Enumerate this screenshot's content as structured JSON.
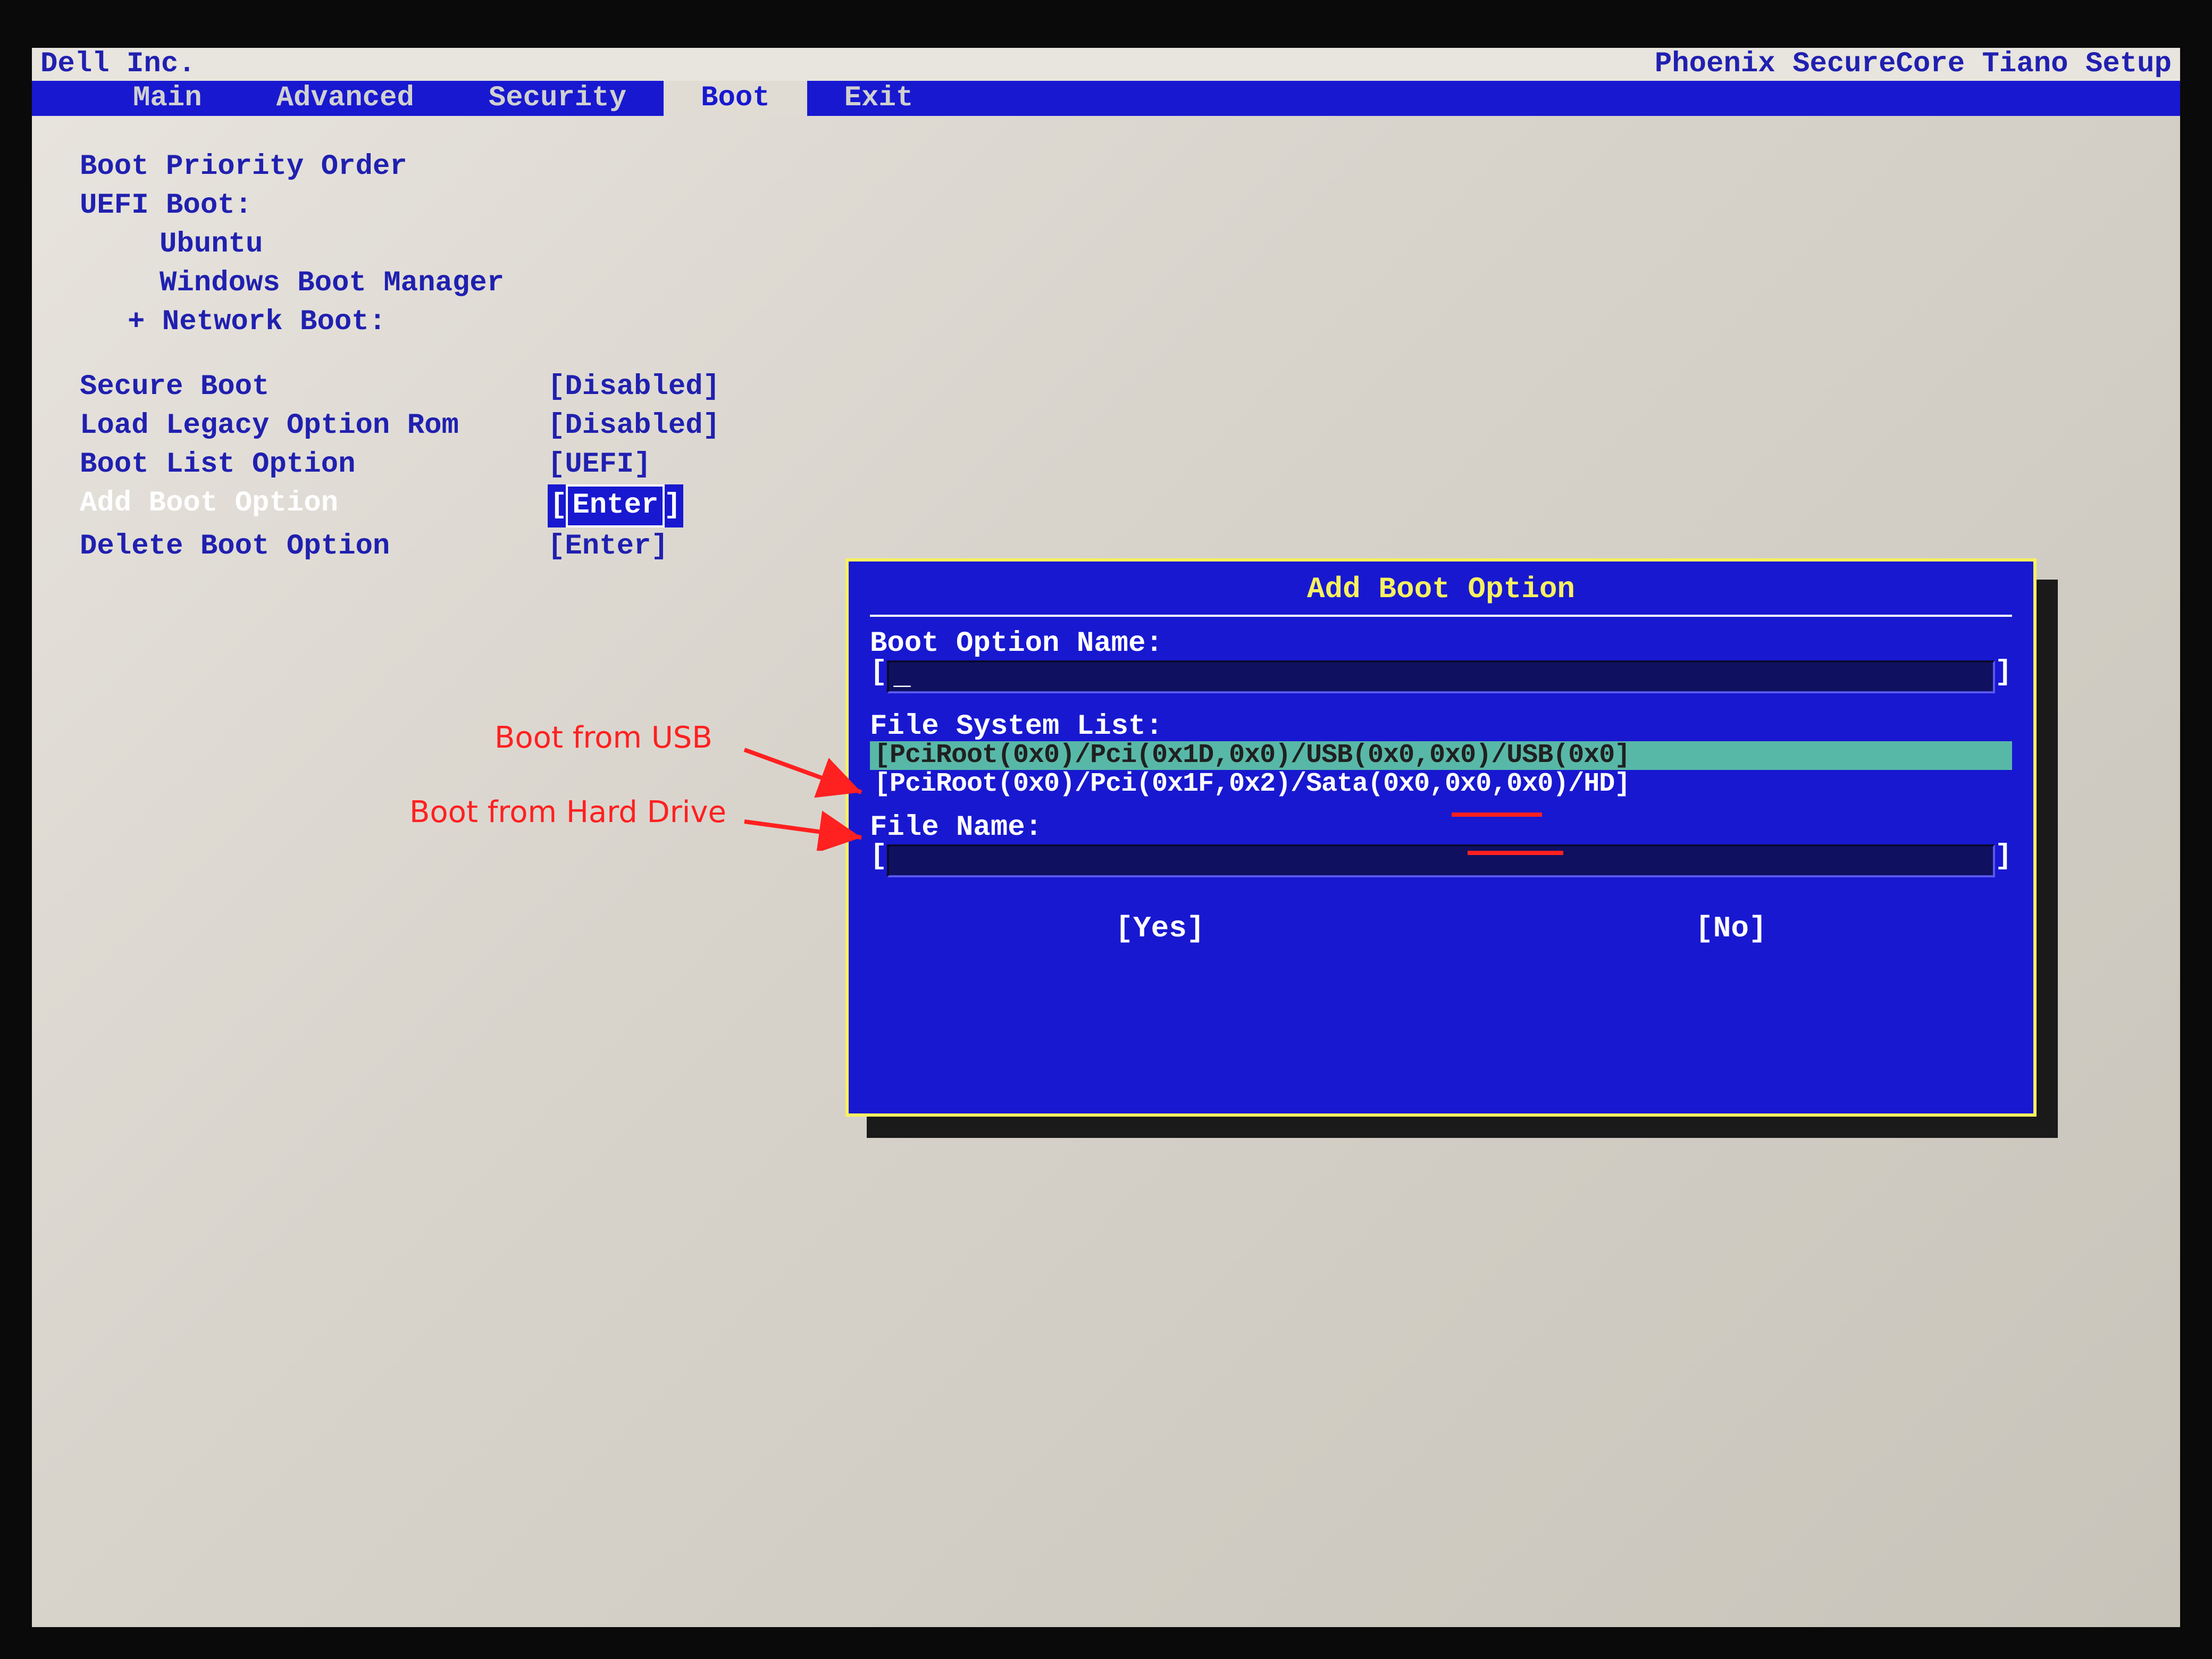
{
  "header": {
    "vendor": "Dell Inc.",
    "title": "Phoenix SecureCore Tiano Setup"
  },
  "menu": {
    "items": [
      "Main",
      "Advanced",
      "Security",
      "Boot",
      "Exit"
    ],
    "active_index": 3
  },
  "boot_page": {
    "heading": "Boot Priority Order",
    "uefi_label": "UEFI Boot:",
    "uefi_items": [
      "Ubuntu",
      "Windows Boot Manager"
    ],
    "network_label": "+ Network Boot:",
    "settings": [
      {
        "label": "Secure Boot",
        "value": "[Disabled]",
        "selected": false
      },
      {
        "label": "Load Legacy Option Rom",
        "value": "[Disabled]",
        "selected": false
      },
      {
        "label": "Boot List Option",
        "value": "[UEFI]",
        "selected": false
      },
      {
        "label": "Add Boot Option",
        "value": "Enter",
        "selected": true
      },
      {
        "label": "Delete Boot Option",
        "value": "[Enter]",
        "selected": false
      }
    ]
  },
  "dialog": {
    "title": "Add Boot Option",
    "opt_name_label": "Boot Option Name:",
    "opt_name_value": "",
    "fs_label": "File System List:",
    "fs_items": [
      {
        "text": "[PciRoot(0x0)/Pci(0x1D,0x0)/USB(0x0,0x0)/USB(0x0]",
        "selected": true
      },
      {
        "text": "[PciRoot(0x0)/Pci(0x1F,0x2)/Sata(0x0,0x0,0x0)/HD]",
        "selected": false
      }
    ],
    "file_name_label": "File Name:",
    "file_name_value": "",
    "yes": "[Yes]",
    "no": "[No]"
  },
  "annotations": {
    "usb": "Boot from USB",
    "hdd": "Boot from Hard Drive"
  }
}
